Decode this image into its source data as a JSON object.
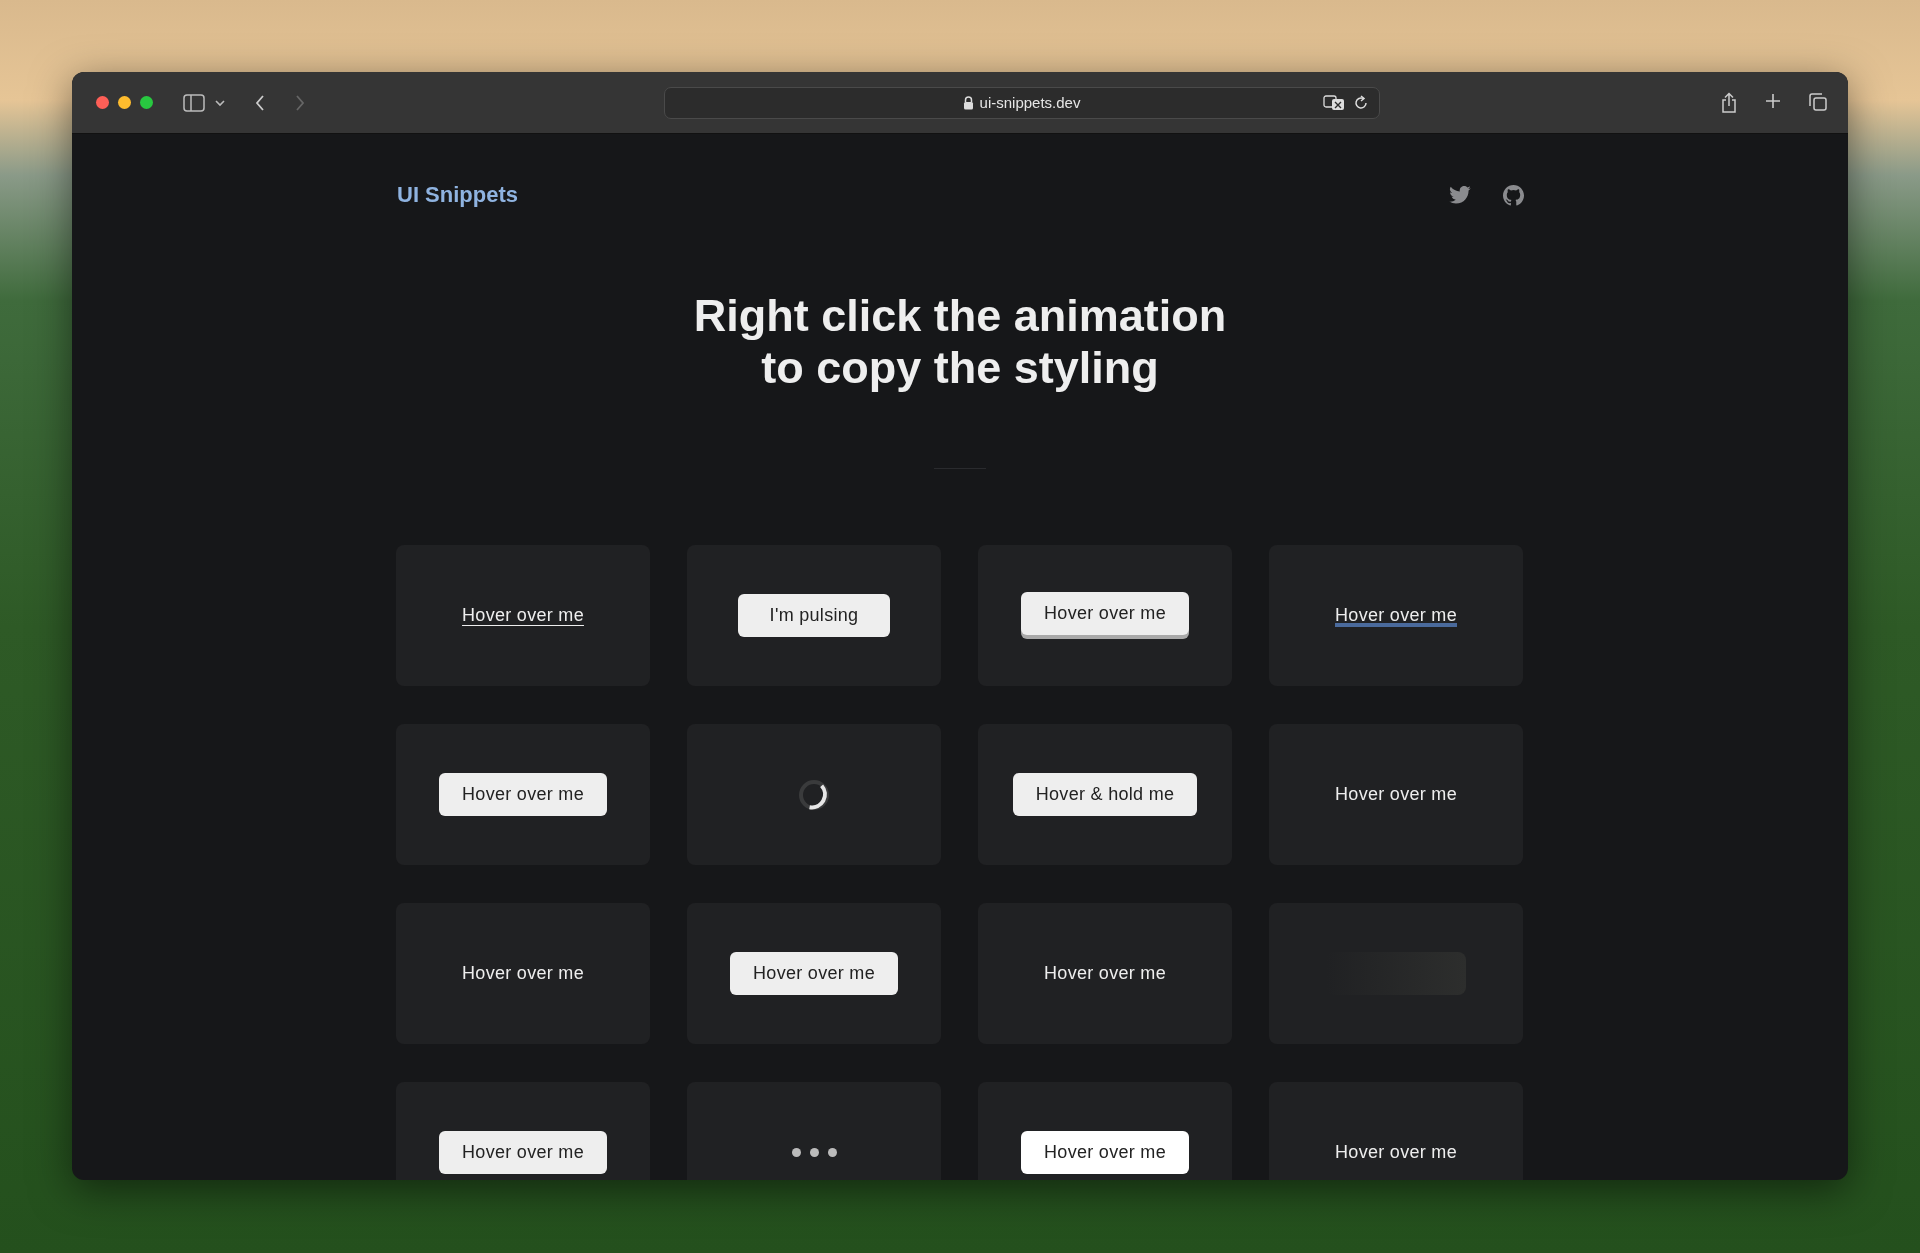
{
  "browser": {
    "url": "ui-snippets.dev"
  },
  "site": {
    "logo": "UI Snippets"
  },
  "hero": {
    "title_lines": [
      "Right click the animation",
      "to copy the styling"
    ]
  },
  "cards": [
    {
      "kind": "underline-link",
      "label": "Hover over me"
    },
    {
      "kind": "button",
      "label": "I'm pulsing"
    },
    {
      "kind": "raised-button",
      "label": "Hover over me"
    },
    {
      "kind": "highlight-link",
      "label": "Hover over me"
    },
    {
      "kind": "button",
      "label": "Hover over me"
    },
    {
      "kind": "spinner"
    },
    {
      "kind": "button",
      "label": "Hover & hold me"
    },
    {
      "kind": "text",
      "label": "Hover over me"
    },
    {
      "kind": "text",
      "label": "Hover over me"
    },
    {
      "kind": "button",
      "label": "Hover over me"
    },
    {
      "kind": "text",
      "label": "Hover over me"
    },
    {
      "kind": "shimmer"
    },
    {
      "kind": "button",
      "label": "Hover over me"
    },
    {
      "kind": "dots"
    },
    {
      "kind": "white-button",
      "label": "Hover over me"
    },
    {
      "kind": "text",
      "label": "Hover over me"
    }
  ]
}
